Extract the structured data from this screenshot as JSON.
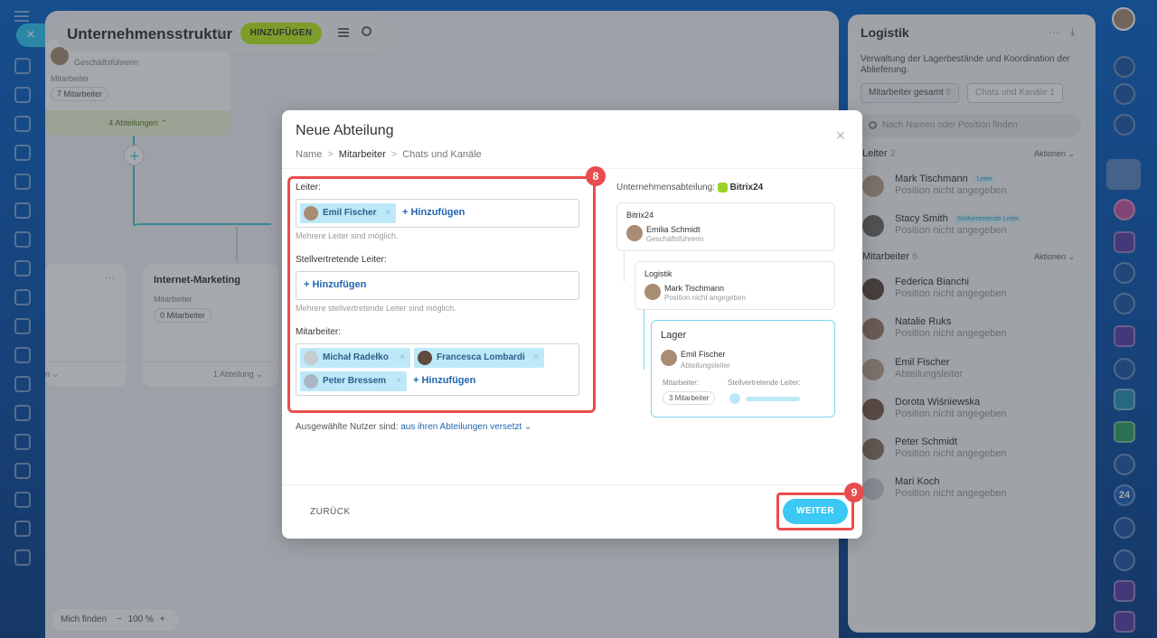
{
  "header": {
    "title": "Unternehmensstruktur",
    "add_label": "HINZUFÜGEN"
  },
  "canvas": {
    "top_card": {
      "role": "Geschäftsführerin",
      "members_label": "Mitarbeiter",
      "members_count": "7 Mitarbeiter",
      "departments_link": "4 Abteilungen"
    },
    "dept_card": {
      "name": "Internet-Marketing",
      "members_label": "Mitarbeiter",
      "members_count": "0 Mitarbeiter",
      "sub_link": "1 Abteilung"
    },
    "zoom": {
      "find_me": "Mich finden",
      "level": "100 %",
      "minus": "−",
      "plus": "+"
    }
  },
  "right_panel": {
    "title": "Logistik",
    "description": "Verwaltung der Lagerbestände und Koordination der Ablieferung.",
    "tabs": [
      {
        "label": "Mitarbeiter gesamt",
        "count": "8"
      },
      {
        "label": "Chats und Kanäle",
        "count": "1"
      }
    ],
    "search_placeholder": "Nach Namen oder Position finden",
    "leads_section": {
      "label": "Leiter",
      "count": "2",
      "actions": "Aktionen"
    },
    "leads": [
      {
        "name": "Mark Tischmann",
        "position": "Position nicht angegeben",
        "tag": "Leiter"
      },
      {
        "name": "Stacy Smith",
        "position": "Position nicht angegeben",
        "tag": "Stellvertretende Leiter"
      }
    ],
    "staff_section": {
      "label": "Mitarbeiter",
      "count": "6",
      "actions": "Aktionen"
    },
    "staff": [
      {
        "name": "Federica Bianchi",
        "position": "Position nicht angegeben"
      },
      {
        "name": "Natalie Ruks",
        "position": "Position nicht angegeben"
      },
      {
        "name": "Emil Fischer",
        "position": "Abteilungsleiter"
      },
      {
        "name": "Dorota Wiśniewska",
        "position": "Position nicht angegeben"
      },
      {
        "name": "Peter Schmidt",
        "position": "Position nicht angegeben"
      },
      {
        "name": "Mari Koch",
        "position": "Position nicht angegeben"
      }
    ]
  },
  "right_rail": {
    "badge_24": "24"
  },
  "modal": {
    "title": "Neue Abteilung",
    "crumbs": [
      "Name",
      "Mitarbeiter",
      "Chats und Kanäle"
    ],
    "leader_label": "Leiter:",
    "leader_chip": "Emil Fischer",
    "add_label": "+ Hinzufügen",
    "leader_hint": "Mehrere Leiter sind möglich.",
    "deputy_label": "Stellvertretende Leiter:",
    "deputy_hint": "Mehrere stellvertretende Leiter sind möglich.",
    "staff_label": "Mitarbeiter:",
    "staff_chips": [
      "Michał Radełko",
      "Francesca Lombardi",
      "Peter Bressem"
    ],
    "moved_prefix": "Ausgewählte Nutzer sind:",
    "moved_link": "aus ihren Abteilungen versetzt",
    "back_label": "ZURÜCK",
    "next_label": "WEITER",
    "tree": {
      "head_prefix": "Unternehmensabteilung:",
      "head_name": "Bitrix24",
      "root": {
        "name": "Bitrix24",
        "person": "Emilia Schmidt",
        "role": "Geschäftsführerin"
      },
      "level1": {
        "name": "Logistik",
        "person": "Mark Tischmann",
        "role": "Position nicht angegeben"
      },
      "level2": {
        "name": "Lager",
        "person": "Emil Fischer",
        "role": "Abteilungsleiter",
        "staff_label": "Mitarbeiter:",
        "staff_count": "3 Mitarbeiter",
        "deputy_label": "Stellvertretende Leiter:"
      }
    }
  },
  "annotations": {
    "step8": "8",
    "step9": "9"
  },
  "colors": {
    "accent_green": "#bbed21",
    "accent_blue": "#3bc8f5",
    "highlight_red": "#e84e4e"
  }
}
